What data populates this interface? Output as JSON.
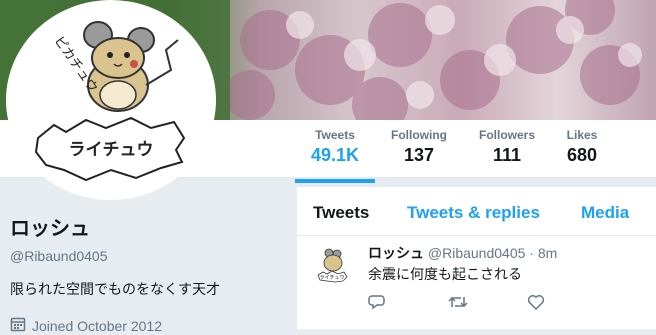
{
  "profile": {
    "name": "ロッシュ",
    "handle": "@Ribaund0405",
    "bio": "限られた空間でものをなくす天才",
    "joined": "Joined October 2012"
  },
  "avatar_art": {
    "top_text": "ピカチュウ",
    "bottom_text": "ライチュウ"
  },
  "stats": [
    {
      "label": "Tweets",
      "value": "49.1K",
      "active": true
    },
    {
      "label": "Following",
      "value": "137"
    },
    {
      "label": "Followers",
      "value": "111"
    },
    {
      "label": "Likes",
      "value": "680"
    }
  ],
  "tabs": [
    {
      "label": "Tweets",
      "active": true
    },
    {
      "label": "Tweets & replies"
    },
    {
      "label": "Media"
    }
  ],
  "tweet": {
    "name": "ロッシュ",
    "handle": "@Ribaund0405",
    "separator": "·",
    "time": "8m",
    "text": "余震に何度も起こされる",
    "avatar_text": "ライチュウ"
  },
  "colors": {
    "accent": "#1da1f2",
    "muted": "#657786",
    "page_bg": "#e6ecf0"
  },
  "icons": [
    "reply-icon",
    "retweet-icon",
    "like-icon",
    "calendar-icon"
  ]
}
